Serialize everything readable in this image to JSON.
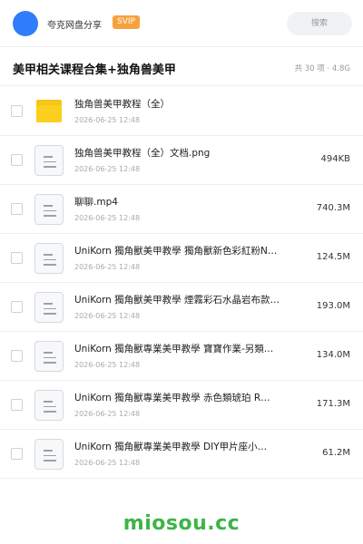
{
  "header": {
    "share_name": "夸克网盘分享",
    "badge": "SVIP",
    "search_placeholder": "搜索"
  },
  "folder": {
    "title": "美甲相关课程合集+独角兽美甲",
    "meta": "共 30 项 · 4.8G"
  },
  "items": [
    {
      "type": "folder",
      "name": "独角兽美甲教程（全）",
      "date": "2026-06-25 12:48",
      "size": ""
    },
    {
      "type": "file",
      "name": "独角兽美甲教程（全）文档.png",
      "date": "2026-06-25 12:48",
      "size": "494KB"
    },
    {
      "type": "file",
      "name": "聊聊.mp4",
      "date": "2026-06-25 12:48",
      "size": "740.3M"
    },
    {
      "type": "file",
      "name": "UniKorn 獨角獸美甲教學 獨角獸新色彩紅粉N…",
      "date": "2026-06-25 12:48",
      "size": "124.5M"
    },
    {
      "type": "file",
      "name": "UniKorn 獨角獸美甲教學 煙霧彩石水晶岩布款…",
      "date": "2026-06-25 12:48",
      "size": "193.0M"
    },
    {
      "type": "file",
      "name": "UniKorn 獨角獸專業美甲教學 寶寶作業-另類…",
      "date": "2026-06-25 12:48",
      "size": "134.0M"
    },
    {
      "type": "file",
      "name": "UniKorn 獨角獸專業美甲教學 赤色類琥珀 R…",
      "date": "2026-06-25 12:48",
      "size": "171.3M"
    },
    {
      "type": "file",
      "name": "UniKorn 獨角獸專業美甲教學 DIY甲片座小…",
      "date": "2026-06-25 12:48",
      "size": "61.2M"
    }
  ],
  "watermark": "miosou.cc",
  "colors": {
    "avatar": "#2f7dfa",
    "badge": "#f7a13c",
    "folder": "#fccf1f",
    "watermark": "#3db446"
  },
  "icons": {
    "folder": "folder-icon",
    "file": "file-icon"
  }
}
